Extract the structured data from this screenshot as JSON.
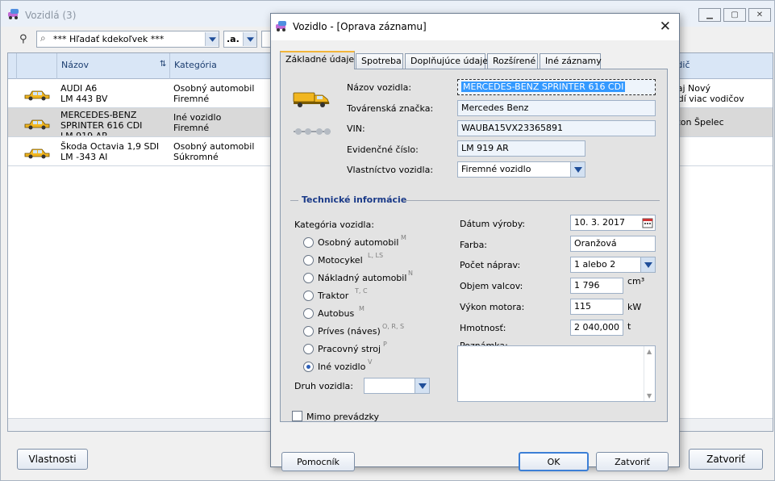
{
  "app": {
    "title": "Vozidlá (3)",
    "search": {
      "value": "*** Hľadať kdekoľvek ***"
    },
    "filter": {
      "value": ".a."
    },
    "columns": {
      "name": "Názov",
      "category": "Kategória",
      "driver": "Vodič"
    },
    "rows": [
      {
        "name": "AUDI A6\nLM 443 BV",
        "category": "Osobný automobil\nFiremné",
        "driver": "Juraj Nový\nJazdí viac vodičov"
      },
      {
        "name": "MERCEDES-BENZ\nSPRINTER 616 CDI\nLM 919 AR",
        "category": "Iné vozidlo\nFiremné",
        "driver": "Anton Špelec"
      },
      {
        "name": "Škoda Octavia 1,9 SDI\nLM -343 AI",
        "category": "Osobný automobil\nSúkromné",
        "driver": ""
      }
    ],
    "buttons": {
      "properties": "Vlastnosti",
      "close": "Zatvoriť"
    }
  },
  "dialog": {
    "title": "Vozidlo - [Oprava záznamu]",
    "tabs": [
      "Základné údaje",
      "Spotreba",
      "Doplňujúce údaje",
      "Rozšírené",
      "Iné záznamy"
    ],
    "labels": {
      "vehicle_name": "Názov vozidla:",
      "brand": "Továrenská značka:",
      "vin": "VIN:",
      "registration": "Evidenčné číslo:",
      "ownership": "Vlastníctvo vozidla:",
      "section_technical": "Technické informácie",
      "category": "Kategória vozidla:",
      "vehicle_type": "Druh vozidla:",
      "out_of_service": "Mimo prevádzky",
      "manufacture_date": "Dátum výroby:",
      "color": "Farba:",
      "axles": "Počet náprav:",
      "displacement": "Objem valcov:",
      "power": "Výkon motora:",
      "weight": "Hmotnosť:",
      "note": "Poznámka:"
    },
    "values": {
      "vehicle_name": "MERCEDES-BENZ SPRINTER 616 CDI",
      "brand": "Mercedes Benz",
      "vin": "WAUBA15VX23365891",
      "registration": "LM 919 AR",
      "ownership": "Firemné vozidlo",
      "vehicle_type": "",
      "manufacture_date": "10. 3. 2017",
      "color": "Oranžová",
      "axles": "1 alebo 2",
      "displacement": "1 796",
      "power": "115",
      "weight": "2 040,000",
      "note": ""
    },
    "units": {
      "displacement": "cm³",
      "power": "kW",
      "weight": "t"
    },
    "categories": [
      {
        "label": "Osobný automobil",
        "code": "M",
        "checked": false
      },
      {
        "label": "Motocykel",
        "code": "L, LS",
        "checked": false
      },
      {
        "label": "Nákladný automobil",
        "code": "N",
        "checked": false
      },
      {
        "label": "Traktor",
        "code": "T, C",
        "checked": false
      },
      {
        "label": "Autobus",
        "code": "M",
        "checked": false
      },
      {
        "label": "Príves (náves)",
        "code": "O, R, S",
        "checked": false
      },
      {
        "label": "Pracovný stroj",
        "code": "P",
        "checked": false
      },
      {
        "label": "Iné vozidlo",
        "code": "V",
        "checked": true
      }
    ],
    "out_of_service_checked": false,
    "buttons": {
      "helper": "Pomocník",
      "ok": "OK",
      "close": "Zatvoriť"
    }
  }
}
